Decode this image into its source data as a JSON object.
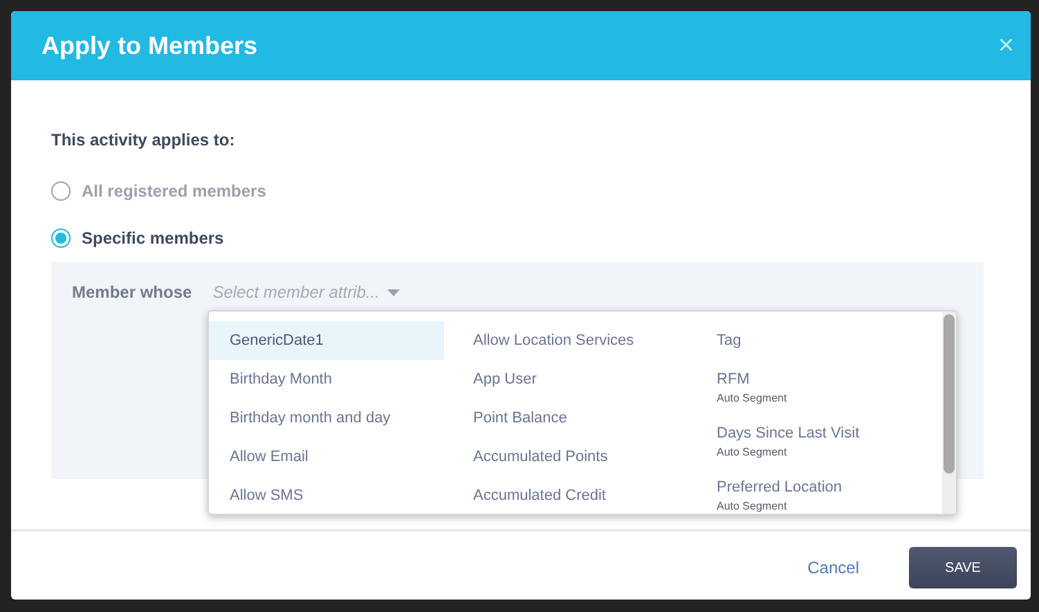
{
  "dialog": {
    "title": "Apply to Members",
    "close": "×"
  },
  "applies_label": "This activity applies to:",
  "options": [
    {
      "label": "All registered members",
      "selected": false
    },
    {
      "label": "Specific members",
      "selected": true
    }
  ],
  "filter": {
    "label": "Member whose",
    "placeholder": "Select member attrib..."
  },
  "menu": {
    "columns": [
      [
        {
          "label": "GenericDate1",
          "selected": true
        },
        {
          "label": "Birthday Month",
          "selected": false
        },
        {
          "label": "Birthday month and day",
          "selected": false
        },
        {
          "label": "Allow Email",
          "selected": false
        },
        {
          "label": "Allow SMS",
          "selected": false
        }
      ],
      [
        {
          "label": "Allow Location Services",
          "selected": false
        },
        {
          "label": "App User",
          "selected": false
        },
        {
          "label": "Point Balance",
          "selected": false
        },
        {
          "label": "Accumulated Points",
          "selected": false
        },
        {
          "label": "Accumulated Credit",
          "selected": false
        }
      ],
      [
        {
          "label": "Tag",
          "selected": false
        },
        {
          "label": "RFM",
          "sublabel": "Auto Segment",
          "selected": false
        },
        {
          "label": "Days Since Last Visit",
          "sublabel": "Auto Segment",
          "selected": false
        },
        {
          "label": "Preferred Location",
          "sublabel": "Auto Segment",
          "selected": false
        }
      ]
    ]
  },
  "buttons": {
    "cancel": "Cancel",
    "save": "SAVE"
  }
}
